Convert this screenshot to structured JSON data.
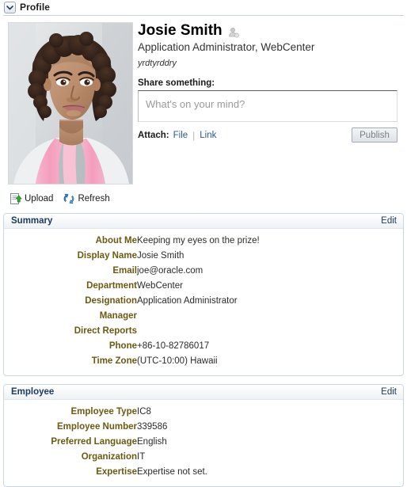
{
  "header": {
    "title": "Profile",
    "disclose_icon": "chevron-down-icon"
  },
  "photo": {
    "alt": "user-photo",
    "actions": [
      {
        "label": "Upload",
        "icon": "upload-document-icon"
      },
      {
        "label": "Refresh",
        "icon": "refresh-arrows-icon"
      }
    ]
  },
  "identity": {
    "name": "Josie Smith",
    "presence_icon": "presence-person-icon",
    "role": "Application Administrator, WebCenter",
    "note": "yrdtyrddry"
  },
  "share": {
    "label": "Share something:",
    "placeholder": "What's on your mind?",
    "value": "",
    "attach_label": "Attach:",
    "attach_file": "File",
    "attach_separator": "|",
    "attach_link": "Link",
    "publish_label": "Publish"
  },
  "sections": [
    {
      "title": "Summary",
      "edit_label": "Edit",
      "fields": [
        {
          "label": "About Me",
          "value": "Keeping my eyes on the prize!"
        },
        {
          "label": "Display Name",
          "value": "Josie Smith"
        },
        {
          "label": "Email",
          "value": "joe@oracle.com"
        },
        {
          "label": "Department",
          "value": "WebCenter"
        },
        {
          "label": "Designation",
          "value": "Application Administrator"
        },
        {
          "label": "Manager",
          "value": ""
        },
        {
          "label": "Direct Reports",
          "value": ""
        },
        {
          "label": "Phone",
          "value": "+86-10-82786017"
        },
        {
          "label": "Time Zone",
          "value": "(UTC-10:00) Hawaii"
        }
      ]
    },
    {
      "title": "Employee",
      "edit_label": "Edit",
      "fields": [
        {
          "label": "Employee Type",
          "value": "IC8"
        },
        {
          "label": "Employee Number",
          "value": "339586"
        },
        {
          "label": "Preferred Language",
          "value": "English"
        },
        {
          "label": "Organization",
          "value": "IT"
        },
        {
          "label": "Expertise",
          "value": "Expertise not set."
        }
      ]
    }
  ],
  "colors": {
    "section_title": "#1f3a60",
    "field_label": "#6b5a12",
    "link": "#2b5797",
    "panel_border": "#cdd5dd"
  }
}
